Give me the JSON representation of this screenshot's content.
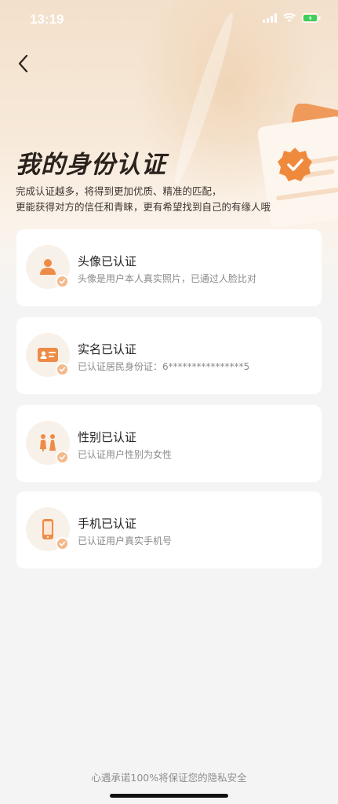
{
  "status_bar": {
    "time": "13:19"
  },
  "header": {
    "title": "我的身份认证",
    "subtitle_line1": "完成认证越多，将得到更加优质、精准的匹配，",
    "subtitle_line2": "更能获得对方的信任和青睐，更有希望找到自己的有缘人哦"
  },
  "cards": [
    {
      "icon": "avatar-icon",
      "title": "头像已认证",
      "desc": "头像是用户本人真实照片，已通过人脸比对"
    },
    {
      "icon": "id-card-icon",
      "title": "实名已认证",
      "desc": "已认证居民身份证：6****************5"
    },
    {
      "icon": "gender-icon",
      "title": "性别已认证",
      "desc": "已认证用户性别为女性"
    },
    {
      "icon": "phone-icon",
      "title": "手机已认证",
      "desc": "已认证用户真实手机号"
    }
  ],
  "footer": {
    "note": "心遇承诺100%将保证您的隐私安全"
  },
  "colors": {
    "accent": "#ee8b47",
    "check": "#f2b98a",
    "card_bg": "#ffffff",
    "page_bg": "#f4f4f4"
  }
}
